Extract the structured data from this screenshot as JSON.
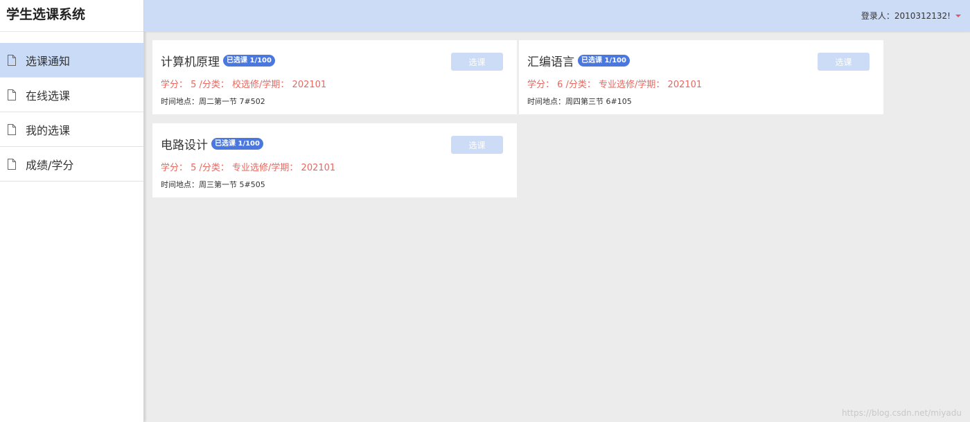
{
  "app": {
    "title": "学生选课系统"
  },
  "header": {
    "user_label": "登录人：2010312132!"
  },
  "sidebar": {
    "items": [
      {
        "label": "选课通知",
        "active": true
      },
      {
        "label": "在线选课",
        "active": false
      },
      {
        "label": "我的选课",
        "active": false
      },
      {
        "label": "成绩/学分",
        "active": false
      }
    ]
  },
  "courses": [
    {
      "name": "计算机原理",
      "badge": "已选课 1/100",
      "button": "选课",
      "info": "学分： 5 /分类： 校选修/学期： 202101",
      "time": "时间地点：周二第一节 7#502"
    },
    {
      "name": "汇编语言",
      "badge": "已选课 1/100",
      "button": "选课",
      "info": "学分： 6 /分类： 专业选修/学期： 202101",
      "time": "时间地点：周四第三节 6#105"
    },
    {
      "name": "电路设计",
      "badge": "已选课 1/100",
      "button": "选课",
      "info": "学分： 5 /分类： 专业选修/学期： 202101",
      "time": "时间地点：周三第一节 5#505"
    }
  ],
  "watermark": "https://blog.csdn.net/miyadu",
  "colors": {
    "accent": "#4a78de",
    "header_bg": "#ccdcf6",
    "active_nav_bg": "#c9dbf7",
    "info_text": "#e8675f",
    "page_bg": "#ececec"
  },
  "icons": {
    "nav_item": "document-icon",
    "user_menu": "caret-down-icon"
  }
}
